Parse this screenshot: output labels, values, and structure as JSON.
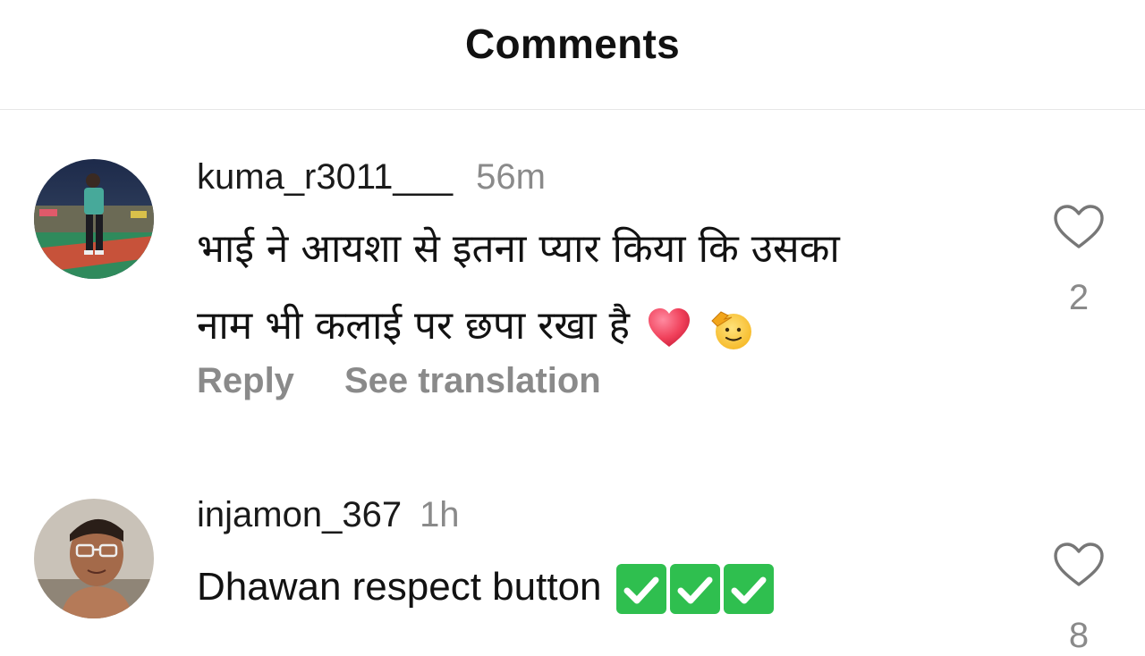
{
  "header": {
    "title": "Comments"
  },
  "comments": [
    {
      "username": "kuma_r3011___",
      "time": "56m",
      "text_line1": "भाई ने आयशा से इतना प्यार किया कि उसका",
      "text_line2": "नाम भी कलाई पर छपा रखा है",
      "emojis": [
        "red-heart",
        "saluting-face"
      ],
      "actions": {
        "reply": "Reply",
        "translate": "See translation"
      },
      "likes": "2"
    },
    {
      "username": "injamon_367",
      "time": "1h",
      "text": "Dhawan respect button",
      "emojis": [
        "check-mark-button",
        "check-mark-button",
        "check-mark-button"
      ],
      "likes": "8"
    }
  ],
  "colors": {
    "muted": "#8a8a8a",
    "heart_emoji": "#f0405a",
    "check_green": "#2fbf4f"
  }
}
